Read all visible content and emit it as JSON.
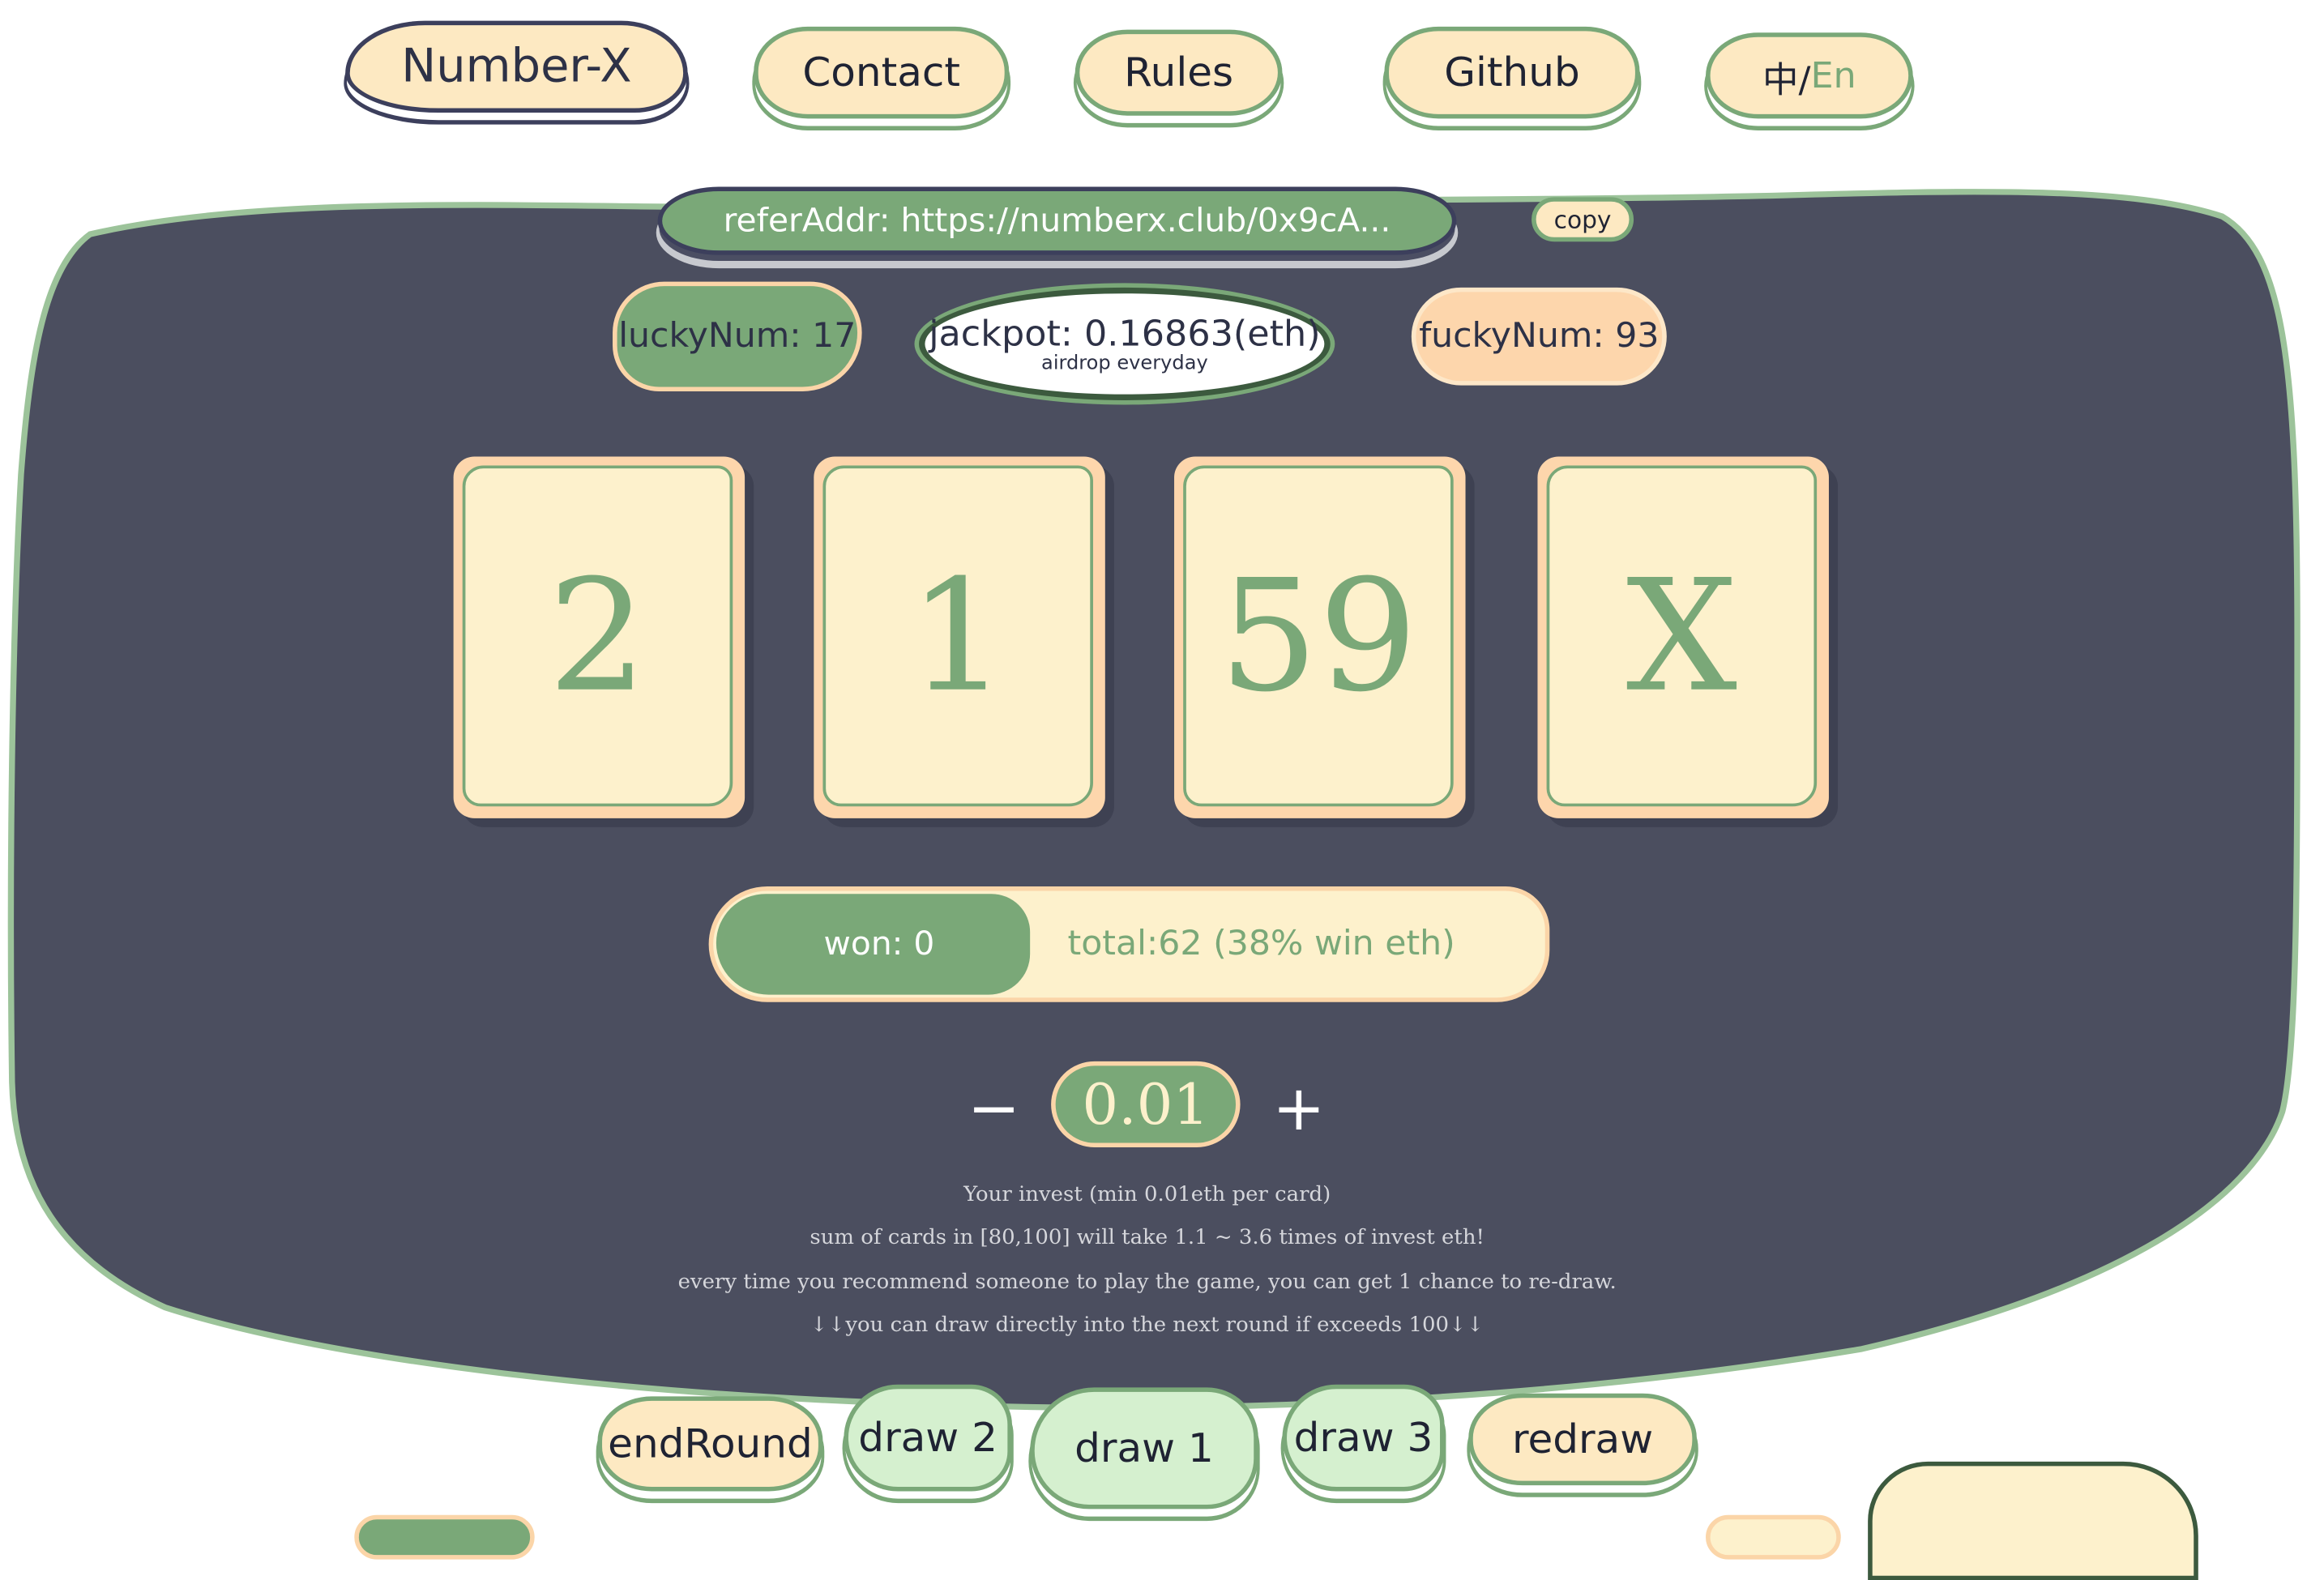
{
  "nav": {
    "logo": "Number-X",
    "contact": "Contact",
    "rules": "Rules",
    "github": "Github",
    "lang_zh": "中/",
    "lang_en": "En"
  },
  "refer": {
    "label": "referAddr: https://numberx.club/0x9cA...",
    "copy": "copy"
  },
  "stats": {
    "lucky": "luckyNum: 17",
    "jackpot": "jackpot: 0.16863(eth)",
    "jackpot_note": "airdrop everyday",
    "fucky": "fuckyNum: 93"
  },
  "cards": [
    "2",
    "1",
    "59",
    "X"
  ],
  "progress": {
    "won": "won: 0",
    "total": "total:62 (38% win eth)",
    "fraction": 0.38
  },
  "invest": {
    "minus": "−",
    "value": "0.01",
    "plus": "+"
  },
  "info": [
    "Your invest (min 0.01eth per card)",
    "sum of cards in [80,100] will take 1.1 ~ 3.6 times of invest eth!",
    "every time you recommend someone to play the game, you can get 1 chance to re-draw.",
    "↓↓you can draw directly into the next round if exceeds 100↓↓"
  ],
  "actions": {
    "end_round": "endRound",
    "draw2": "draw 2",
    "draw1": "draw 1",
    "draw3": "draw 3",
    "redraw": "redraw"
  },
  "colors": {
    "table": "#4b4e5f",
    "table_border": "#9cc39a",
    "green": "#7aa878",
    "cream": "#fdf1cc",
    "peach": "#fdd6ac"
  }
}
